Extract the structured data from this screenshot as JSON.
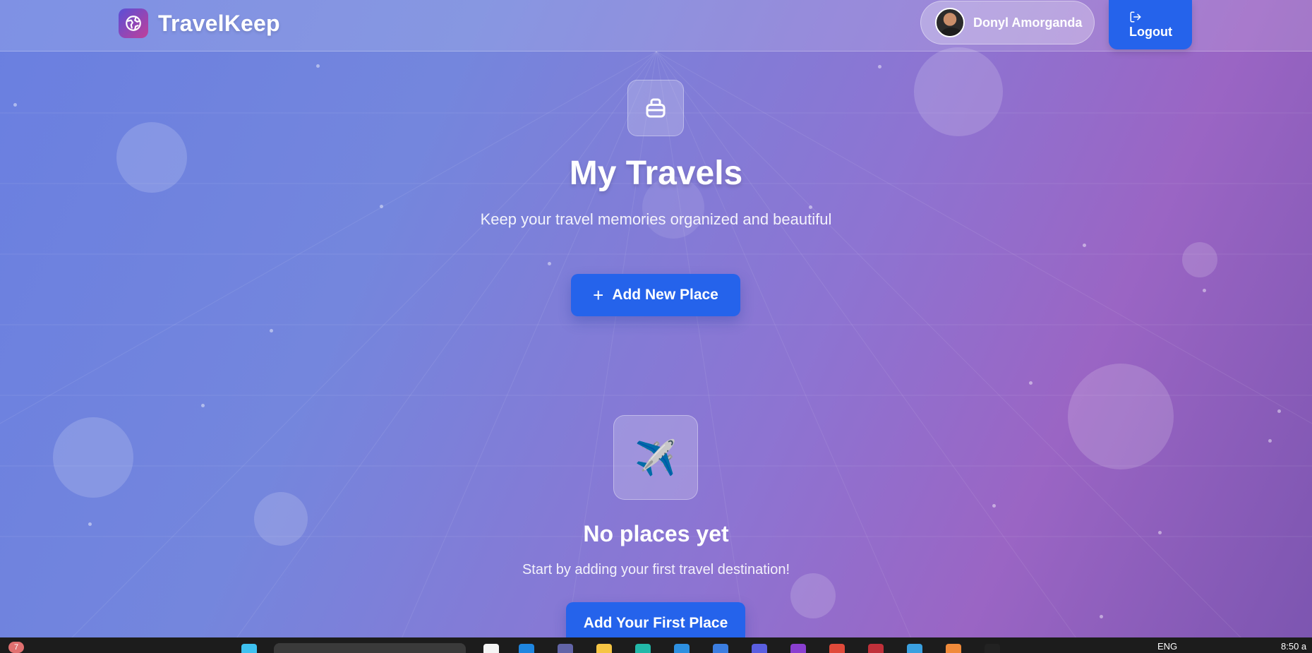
{
  "header": {
    "brand_name": "TravelKeep",
    "user_name": "Donyl Amorganda",
    "logout_label": "Logout"
  },
  "hero": {
    "title": "My Travels",
    "subtitle": "Keep your travel memories organized and beautiful",
    "add_button_label": "Add New Place",
    "add_button_icon": "+"
  },
  "empty_state": {
    "icon": "✈️",
    "title": "No places yet",
    "subtitle": "Start by adding your first travel destination!",
    "button_label": "Add Your First Place"
  },
  "taskbar": {
    "notification_count": "7",
    "language": "ENG",
    "time": "8:50 a"
  },
  "colors": {
    "primary_button": "#2563eb",
    "brand_logo_start": "#5a4fd6",
    "brand_logo_end": "#c0409a"
  }
}
